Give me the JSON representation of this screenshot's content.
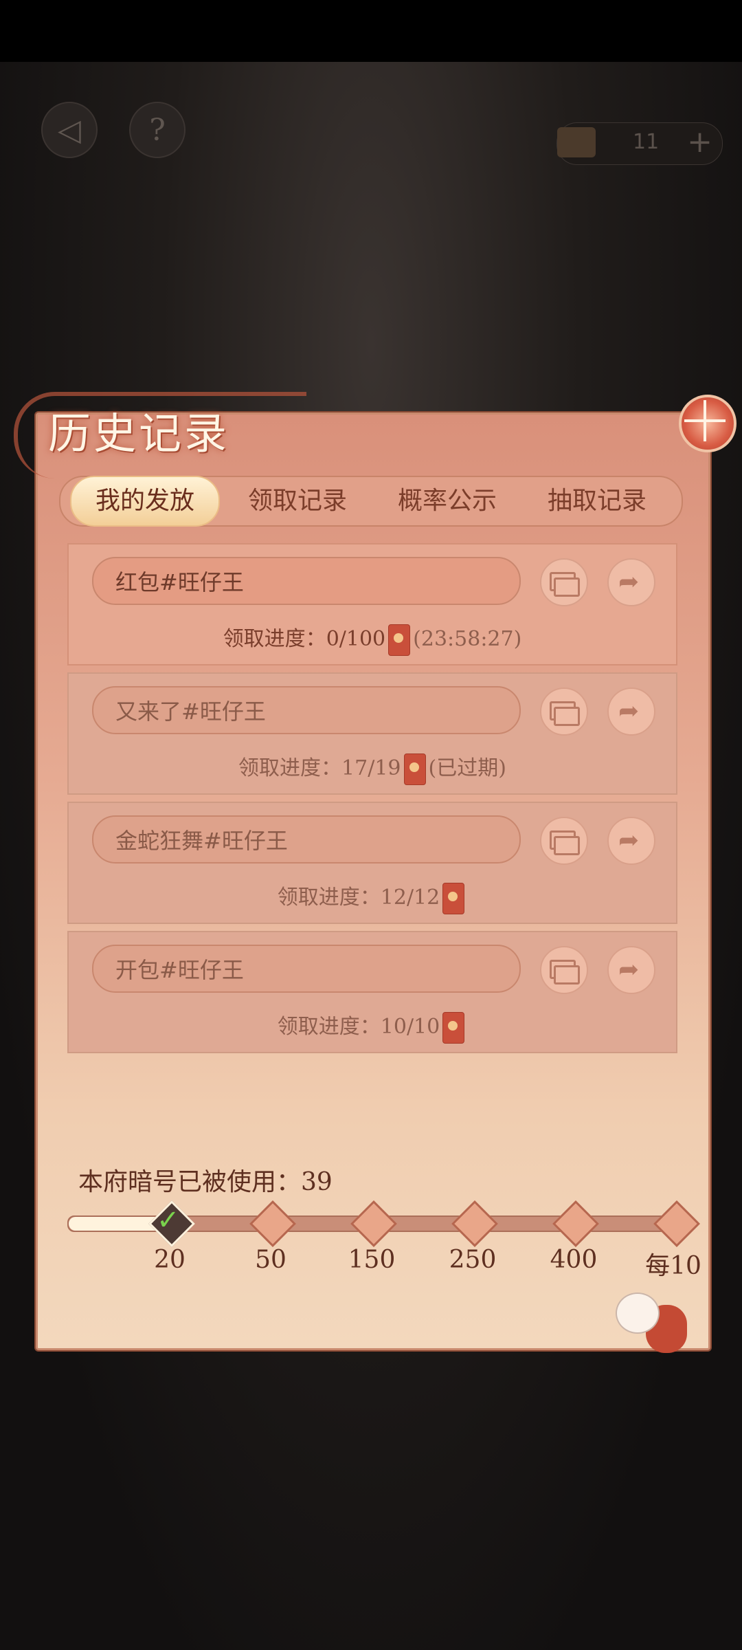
{
  "hud": {
    "back_icon": "back-arrow-icon",
    "help_label": "?",
    "currency_count": "11",
    "plus_label": "+"
  },
  "panel": {
    "title": "历史记录"
  },
  "tabs": [
    {
      "label": "我的发放",
      "active": true
    },
    {
      "label": "领取记录",
      "active": false
    },
    {
      "label": "概率公示",
      "active": false
    },
    {
      "label": "抽取记录",
      "active": false
    }
  ],
  "records": [
    {
      "name": "红包#旺仔王",
      "progress_label": "领取进度：",
      "progress": "0/100",
      "status": "(23:58:27)"
    },
    {
      "name": "又来了#旺仔王",
      "progress_label": "领取进度：",
      "progress": "17/19",
      "status": "(已过期)"
    },
    {
      "name": "金蛇狂舞#旺仔王",
      "progress_label": "领取进度：",
      "progress": "12/12",
      "status": ""
    },
    {
      "name": "开包#旺仔王",
      "progress_label": "领取进度：",
      "progress": "10/10",
      "status": ""
    }
  ],
  "usage": {
    "label": "本府暗号已被使用：",
    "count": "39",
    "fill_fraction": 0.18
  },
  "milestones": [
    "20",
    "50",
    "150",
    "250",
    "400",
    "每10"
  ],
  "colors": {
    "accent": "#c94f3a",
    "panel": "#e6ab93",
    "check": "#7ad34d"
  }
}
